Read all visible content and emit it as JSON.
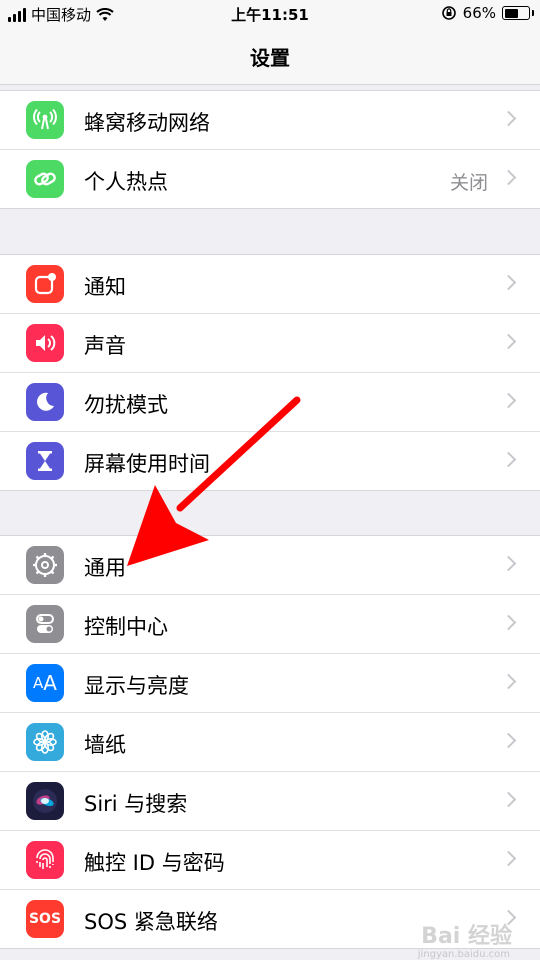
{
  "status": {
    "carrier": "中国移动",
    "time": "上午11:51",
    "battery": "66%",
    "battery_level": 0.66
  },
  "nav": {
    "title": "设置"
  },
  "groups": [
    {
      "items": [
        {
          "label": "蜂窝移动网络",
          "icon": "antenna-icon",
          "color": "#4cd964"
        },
        {
          "label": "个人热点",
          "value": "关闭",
          "icon": "hotspot-link-icon",
          "color": "#4cd964"
        }
      ]
    },
    {
      "items": [
        {
          "label": "通知",
          "icon": "notification-icon",
          "color": "#ff3b30"
        },
        {
          "label": "声音",
          "icon": "speaker-icon",
          "color": "#ff2d55"
        },
        {
          "label": "勿扰模式",
          "icon": "moon-icon",
          "color": "#5856d6"
        },
        {
          "label": "屏幕使用时间",
          "icon": "hourglass-icon",
          "color": "#5856d6"
        }
      ]
    },
    {
      "items": [
        {
          "label": "通用",
          "icon": "gear-icon",
          "color": "#8e8e93"
        },
        {
          "label": "控制中心",
          "icon": "toggle-switches-icon",
          "color": "#8e8e93"
        },
        {
          "label": "显示与亮度",
          "icon": "text-size-icon",
          "color": "#007aff"
        },
        {
          "label": "墙纸",
          "icon": "flower-icon",
          "color": "#34aadc"
        },
        {
          "label": "Siri 与搜索",
          "icon": "siri-icon",
          "color": "#1c1c3c"
        },
        {
          "label": "触控 ID 与密码",
          "icon": "fingerprint-icon",
          "color": "#ff2d55"
        },
        {
          "label": "SOS 紧急联络",
          "icon": "sos-icon",
          "color": "#ff3b30",
          "icon_text": "SOS"
        }
      ]
    }
  ],
  "watermark": {
    "main": "Bai 经验",
    "sub": "jingyan.baidu.com"
  }
}
